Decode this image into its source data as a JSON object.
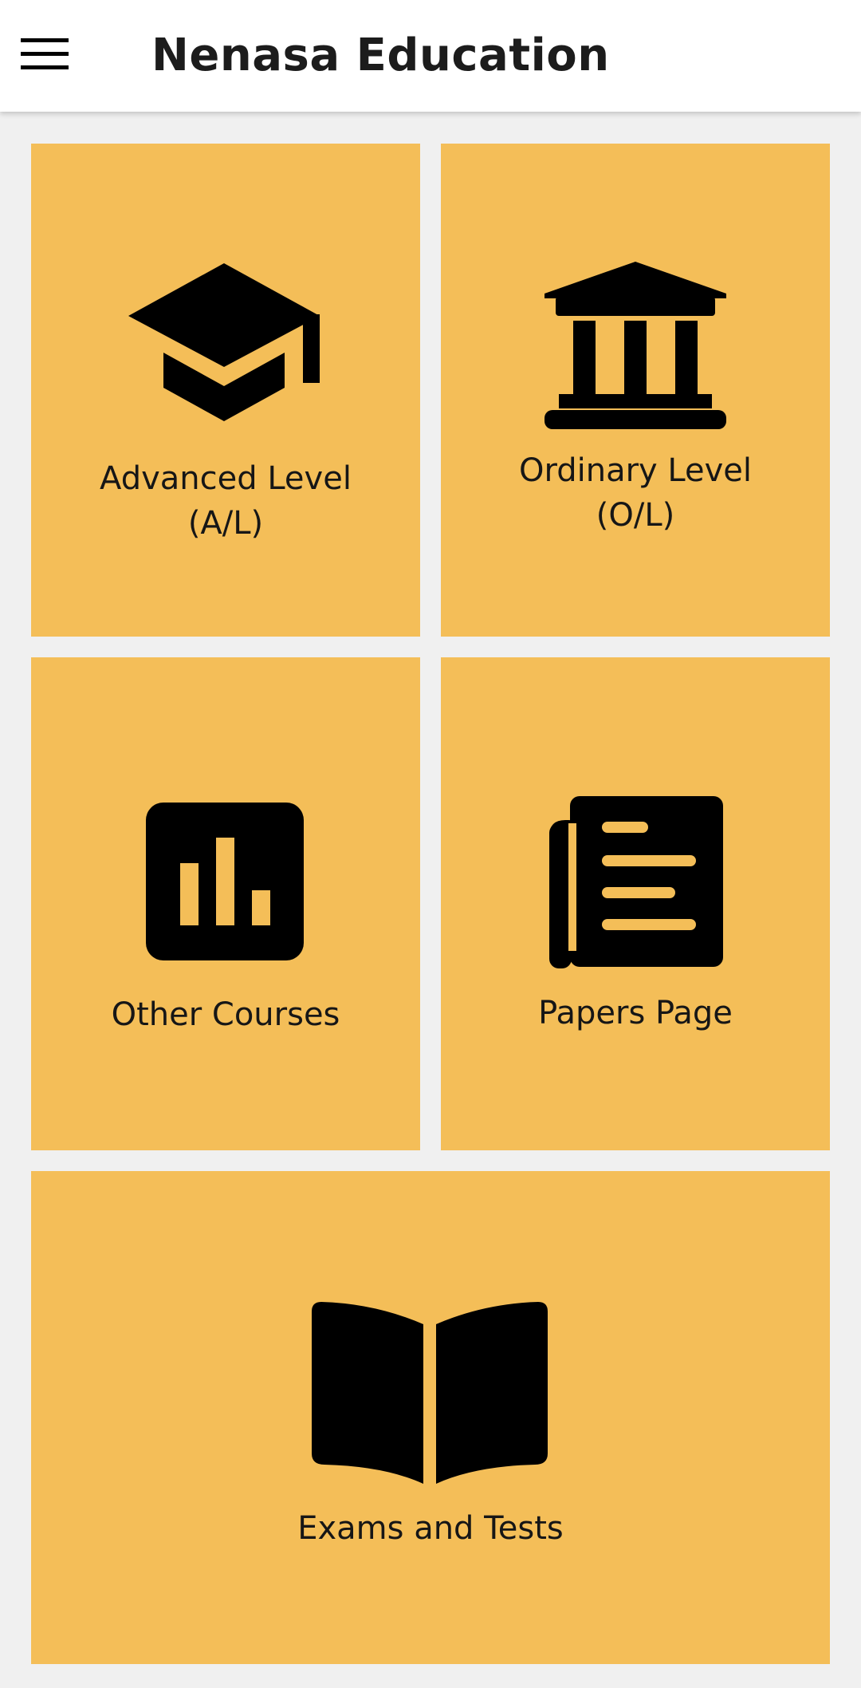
{
  "app": {
    "title": "Nenasa Education"
  },
  "colors": {
    "tile_background": "#f4be58",
    "page_background": "#f0f0f0",
    "appbar_background": "#ffffff",
    "icon_color": "#000000"
  },
  "tiles": [
    {
      "id": "advanced-level",
      "icon": "graduation-cap-icon",
      "line1": "Advanced Level",
      "line2": "(A/L)"
    },
    {
      "id": "ordinary-level",
      "icon": "bank-building-icon",
      "line1": "Ordinary Level",
      "line2": "(O/L)"
    },
    {
      "id": "other-courses",
      "icon": "bar-chart-icon",
      "line1": "Other Courses"
    },
    {
      "id": "papers-page",
      "icon": "newspaper-icon",
      "line1": "Papers Page"
    },
    {
      "id": "exams-and-tests",
      "icon": "open-book-icon",
      "line1": "Exams and Tests"
    }
  ]
}
